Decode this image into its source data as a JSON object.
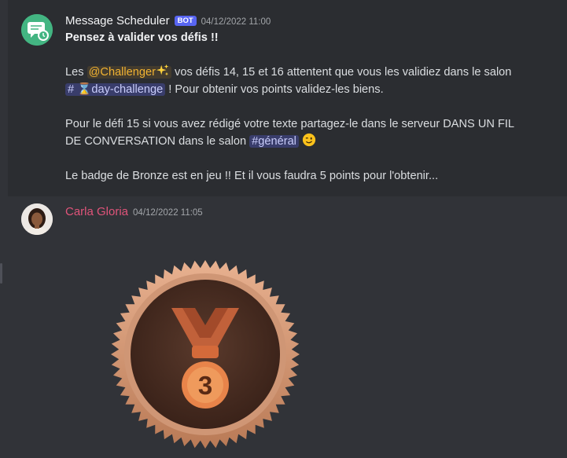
{
  "bot_message": {
    "username": "Message Scheduler",
    "tag": "BOT",
    "timestamp": "04/12/2022 11:00",
    "title": "Pensez à valider vos défis !!",
    "p1_pre": "Les ",
    "mention": "@Challenger",
    "p1_mid": " vos défis 14, 15 et 16 attentent que vous les validiez dans le salon",
    "channel1": "# ⌛day-challenge",
    "p1_end": " ! Pour obtenir vos points validez-les biens.",
    "p2_line1": "Pour le défi 15 si vous avez rédigé votre texte partagez-le dans le serveur DANS UN FIL",
    "p2_line2_pre": "DE CONVERSATION dans le salon ",
    "channel2": "#général",
    "p3": "Le badge de Bronze est en jeu !! Et il vous faudra 5 points pour l'obtenir..."
  },
  "user_message": {
    "username": "Carla Gloria",
    "timestamp": "04/12/2022 11:05",
    "image": {
      "medal_number": "3"
    }
  },
  "colors": {
    "background": "#313338",
    "highlight_background": "#2b2d31",
    "bot_tag": "#5865f2",
    "user_name": "#e0547a",
    "mention": "#f0b232",
    "channel": "#c9cdfb",
    "bronze": "#c88a63"
  },
  "icons": [
    "chat-bubble-clock-icon",
    "sparkles-emoji-icon",
    "winking-face-emoji-icon",
    "bronze-medal-icon"
  ]
}
